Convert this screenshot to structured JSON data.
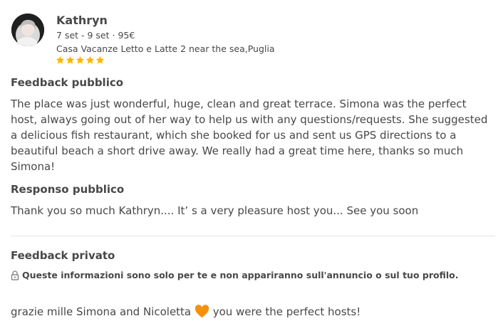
{
  "reviewer": {
    "name": "Kathryn",
    "dates_price": "7 set - 9 set · 95€",
    "listing": "Casa Vacanze Letto e Latte 2 near the sea,Puglia",
    "rating": 5,
    "star_color": "#FFB400"
  },
  "public_feedback": {
    "title": "Feedback pubblico",
    "text": "The place was just wonderful, huge, clean and great terrace. Simona was the perfect host, always going out of her way to help us with any questions/requests. She suggested a delicious fish restaurant, which she booked for us and sent us GPS directions to a beautiful beach a short drive away. We really had a great time here, thanks so much Simona!"
  },
  "public_response": {
    "title": "Responso pubblico",
    "text": "Thank you so much Kathryn.... It’ s a very pleasure host you... See you soon"
  },
  "private_feedback": {
    "title": "Feedback privato",
    "privacy_note": "Queste informazioni sono solo per te e non appariranno sull'annuncio o sul tuo profilo.",
    "privacy_icon": "lock-icon",
    "text_before": "grazie mille Simona and Nicoletta",
    "emoji": "orange-heart-icon",
    "text_after": "you were the perfect hosts!"
  }
}
